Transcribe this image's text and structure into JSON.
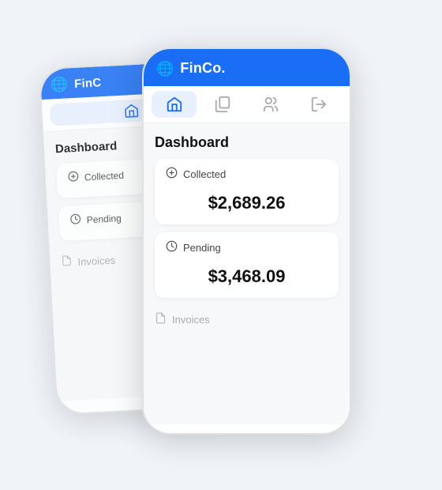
{
  "app": {
    "name": "FinCo.",
    "logo_symbol": "🌐"
  },
  "nav": {
    "items": [
      {
        "id": "home",
        "label": "Home",
        "active": true
      },
      {
        "id": "copy",
        "label": "Documents",
        "active": false
      },
      {
        "id": "users",
        "label": "Users",
        "active": false
      },
      {
        "id": "logout",
        "label": "Logout",
        "active": false
      }
    ]
  },
  "dashboard": {
    "title": "Dashboard",
    "cards": [
      {
        "id": "collected",
        "label": "Collected",
        "icon": "dollar",
        "amount": "$2,689.26"
      },
      {
        "id": "pending",
        "label": "Pending",
        "icon": "clock",
        "amount": "$3,468.09"
      }
    ],
    "invoices_label": "Invoices"
  }
}
